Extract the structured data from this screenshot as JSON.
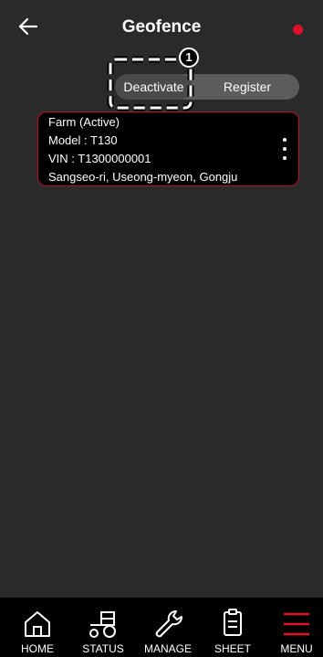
{
  "header": {
    "title": "Geofence",
    "status_dot_color": "#e0102a"
  },
  "toggle": {
    "deactivate_label": "Deactivate",
    "register_label": "Register",
    "selected": "Deactivate"
  },
  "annotation": {
    "marker_number": "1"
  },
  "geofences": [
    {
      "name": "Farm (Active)",
      "model": "Model : T130",
      "vin": "VIN : T1300000001",
      "address": "Sangseo-ri, Useong-myeon, Gongju"
    }
  ],
  "nav": {
    "items": [
      {
        "label": "HOME",
        "icon": "home-icon"
      },
      {
        "label": "STATUS",
        "icon": "tractor-icon"
      },
      {
        "label": "MANAGE",
        "icon": "wrench-icon"
      },
      {
        "label": "SHEET",
        "icon": "clipboard-icon"
      },
      {
        "label": "MENU",
        "icon": "hamburger-menu-icon"
      }
    ],
    "accent_color": "#e0102a"
  }
}
